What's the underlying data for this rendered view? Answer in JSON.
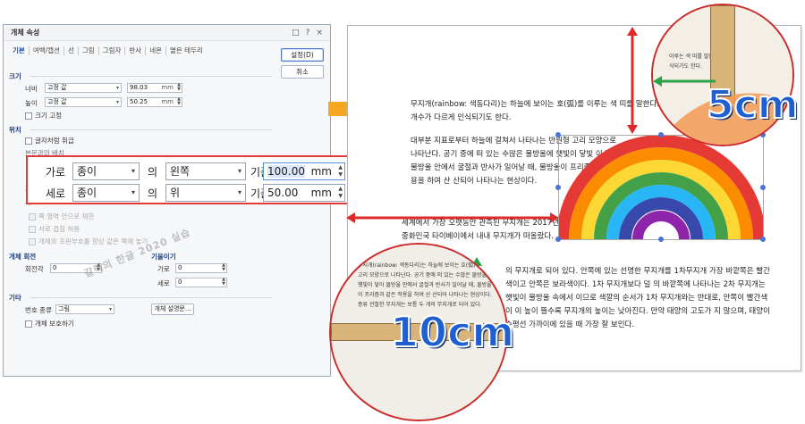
{
  "dialog": {
    "title": "개체 속성",
    "title_icons": [
      "□",
      "?",
      "×"
    ],
    "tabs": [
      "기본",
      "여백/캡션",
      "선",
      "그림",
      "그림자",
      "반사",
      "네온",
      "옅은 테두리"
    ],
    "ok_label": "설정(D)",
    "cancel_label": "취소",
    "size": {
      "title": "크기",
      "width_label": "너비",
      "width_mode": "고정 값",
      "width_value": "98.03",
      "height_label": "높이",
      "height_mode": "고정 값",
      "height_value": "50.25",
      "unit": "mm",
      "fix_size": "크기 고정"
    },
    "position": {
      "title": "위치",
      "treat_as_char": "글자처럼 취급",
      "placement_label": "본문과의 배치",
      "horiz_label_cut": "가로",
      "vert_label_cut": "세로",
      "opt_move_with_obj": "쪽 영역 안으로 제한",
      "opt_overlap": "서로 겹침 허용",
      "opt_keep_with": "개체와 조판부호를 항상 같은 쪽에 놓기"
    },
    "rotate": {
      "title": "개체 회전",
      "angle_label": "회전각",
      "angle_value": "0"
    },
    "skew": {
      "title": "기울이기",
      "h_label": "가로",
      "h_value": "0",
      "v_label": "세로",
      "v_value": "0"
    },
    "etc": {
      "title": "기타",
      "number_type_label": "번호 종류",
      "number_type_value": "그림",
      "desc_button": "개체 설명문...",
      "protect": "개체 보호하기"
    },
    "highlight": {
      "row1": {
        "label": "가로",
        "ref": "종이",
        "particle": "의",
        "align": "왼쪽",
        "base": "기준",
        "value": "100.00",
        "unit": "mm"
      },
      "row2": {
        "label": "세로",
        "ref": "종이",
        "particle": "의",
        "align": "위",
        "base": "기준",
        "value": "50.00",
        "unit": "mm"
      }
    },
    "watermark": "갈렉의 한글 2020 실습"
  },
  "document": {
    "para1": "무지개(rainbow: 색동다리)는 하늘에 보이는 호(弧)를 이루는 색 띠를 말한다. 지 않아 각 문화권마다 색의 개수가 다르게 인식되기도 한다.",
    "para2": "대부분 지표로부터 하늘에 걸쳐서 나타나는 반원형 고리 모양으로 나타난다. 공기 중에 떠 있는 수많은 물방울에 햇빛이 닿빛 이 닿아 물방울 안에서 굴절과 반사가 일어날 때, 물방울이 프리즘과 같은 작용을 하여 산 산되어 나타나는 현상이다.",
    "para3": "세계에서 가장 오랫동안 관측된 무지개는 2017년 중화민국 타이베이에서 내내 무지개가 떠올랐다.",
    "para4": "의 무지개로 되어 있다. 안쪽에 있는 선명한 무지개를 1차무지개 가장 바깥쪽은 빨간색이고 안쪽은 보라색이다. 1차 무지개보다 덜 의 바깥쪽에 나타나는 2차 무지개는 햇빛이 물방울 속에서 이므로 색깔의 순서가 1차 무지개와는 반대로, 안쪽이 빨간색이 이 높이 뜰수록 무지개의 높이는 낮아진다. 만약 태양의 고도가 지 않으며, 태양이 수평선 가까이에 있을 때 가장 잘 보인다.",
    "label_5cm": "5cm",
    "label_10cm": "10cm",
    "zoom_top_text": "이루는 색 띠를 말한 인식되기도 한다.",
    "zoom_bottom_text": "무지개(rainbow: 색동다리)는 하늘에 보이는 호(弧) 반원형 고리 모양으로 나타난다. 공기 중에 떠 있는 수많은 물방울 햇빛이 닿아 물방울 안에서 굴절과 반사가 일어날 때, 물방울이 프리즘과 같은 작용을 하여 산 산되어 나타나는 현상이다. 종류 관찰한 무지개는 보통 두 개의 무지개로 되어 있다."
  },
  "colors": {
    "highlight_border": "#e03a3a",
    "accent_blue": "#1f5fd1",
    "arrow_orange": "#f5a623",
    "measure_red": "#e02a2a",
    "measure_green": "#2ca24a"
  }
}
